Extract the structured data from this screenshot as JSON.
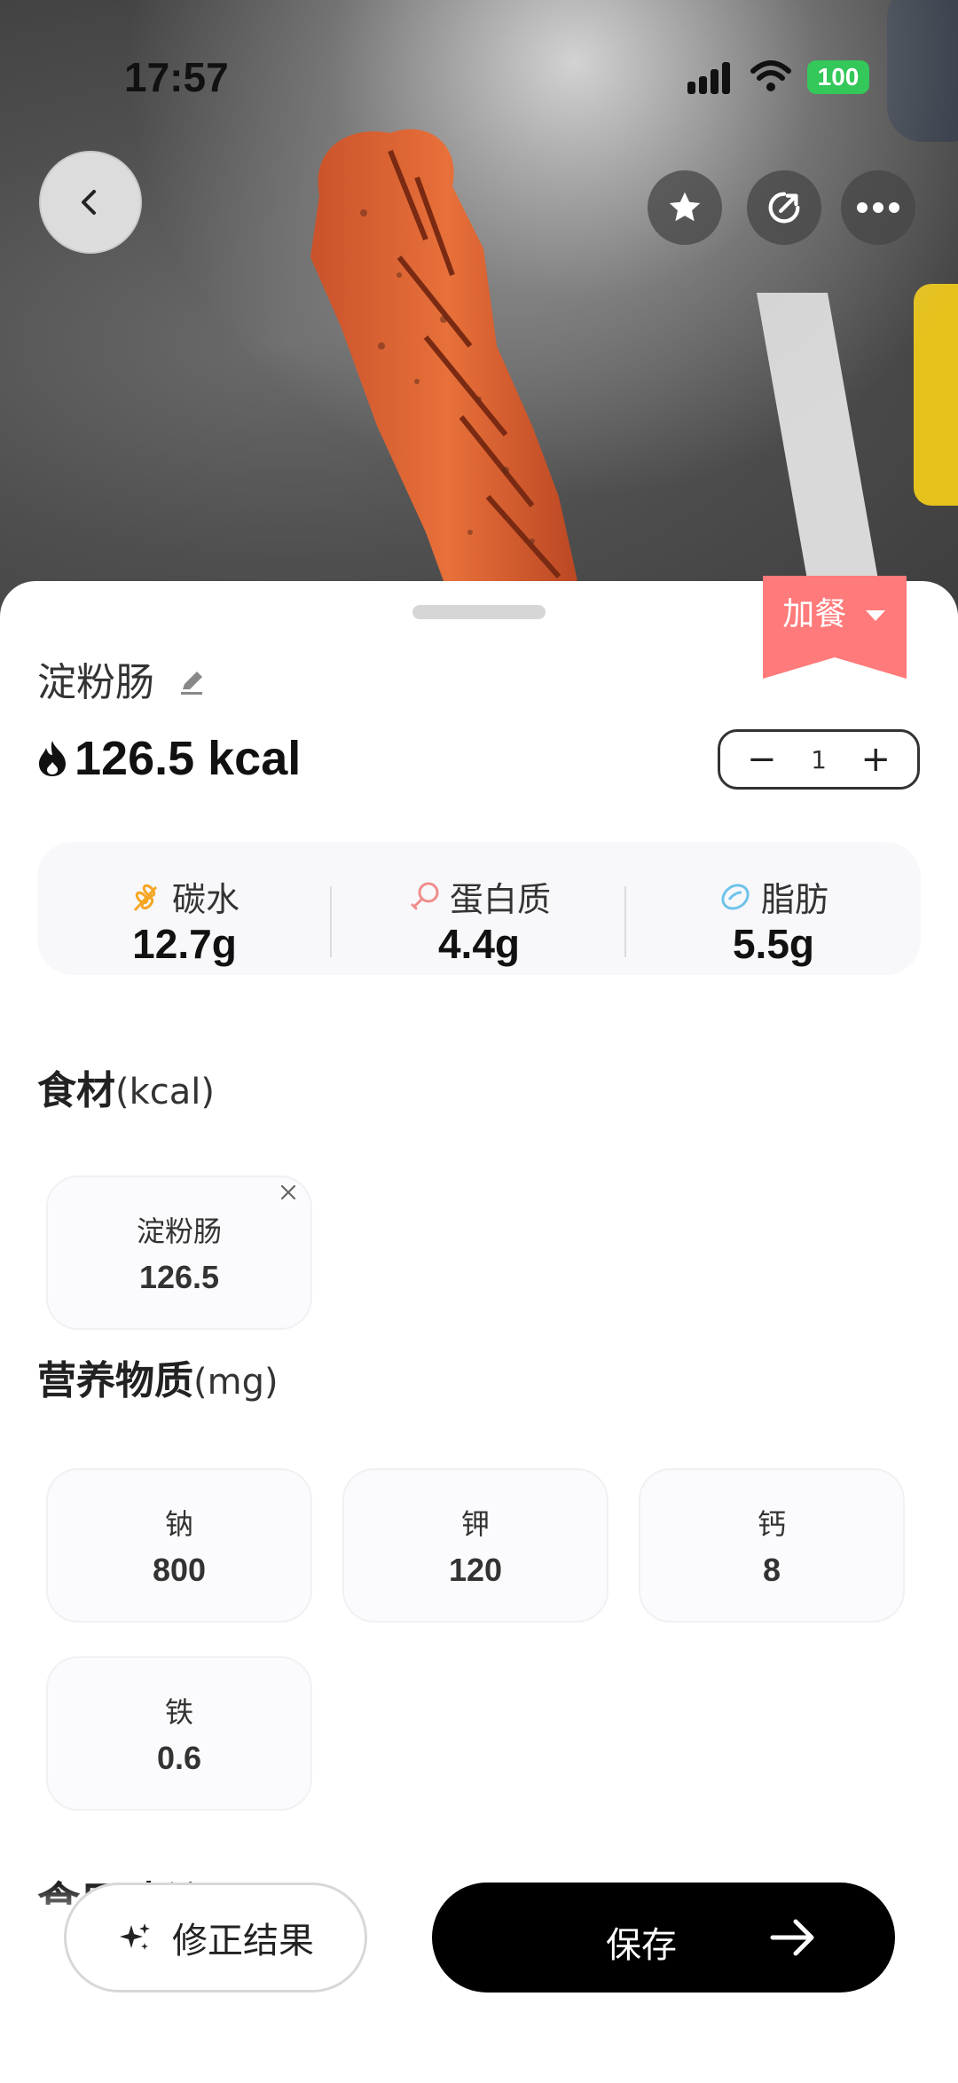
{
  "status_bar": {
    "time": "17:57",
    "battery": "100"
  },
  "sheet": {
    "meal_tag": "加餐",
    "food_name": "淀粉肠",
    "calories": "126.5 kcal",
    "quantity": "1",
    "macros": [
      {
        "label": "碳水",
        "value": "12.7g",
        "icon": "wheat-icon",
        "color": "#f5a623"
      },
      {
        "label": "蛋白质",
        "value": "4.4g",
        "icon": "drumstick-icon",
        "color": "#f08c8c"
      },
      {
        "label": "脂肪",
        "value": "5.5g",
        "icon": "oil-drop-icon",
        "color": "#6ec3e8"
      }
    ],
    "ingredients": {
      "title": "食材",
      "unit": "(kcal)",
      "items": [
        {
          "name": "淀粉肠",
          "value": "126.5"
        }
      ]
    },
    "nutrients": {
      "title": "营养物质",
      "unit": "(mg)",
      "items": [
        {
          "name": "钠",
          "value": "800"
        },
        {
          "name": "钾",
          "value": "120"
        },
        {
          "name": "钙",
          "value": "8"
        },
        {
          "name": "铁",
          "value": "0.6"
        }
      ]
    },
    "next_section_partial": "食用建议"
  },
  "actions": {
    "fix_label": "修正结果",
    "save_label": "保存"
  },
  "colors": {
    "meal_tag": "#ff7a7a",
    "save_button": "#000000",
    "battery": "#34c759"
  }
}
